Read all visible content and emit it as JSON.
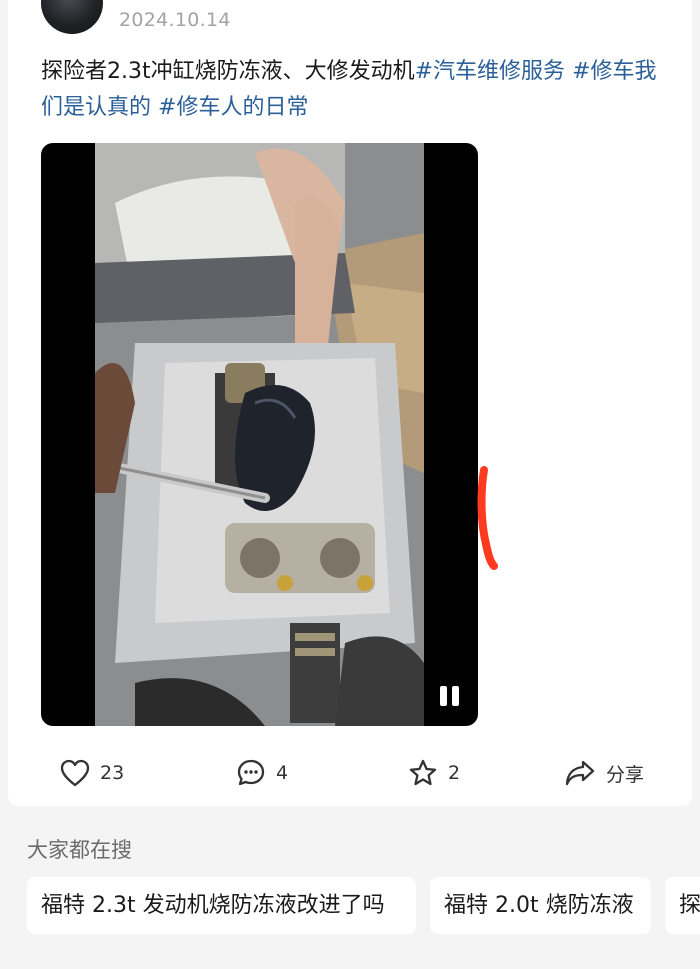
{
  "post": {
    "date": "2024.10.14",
    "text_main": "探险者2.3t冲缸烧防冻液、大修发动机",
    "tags": [
      "#汽车维修服务",
      "#修车我们是认真的",
      "#修车人的日常"
    ]
  },
  "video": {
    "state": "playing",
    "pause_icon": "pause-icon"
  },
  "actions": {
    "like": {
      "icon": "heart-icon",
      "count": "23"
    },
    "comment": {
      "icon": "comment-icon",
      "count": "4"
    },
    "favorite": {
      "icon": "star-icon",
      "count": "2"
    },
    "share": {
      "icon": "share-icon",
      "label": "分享"
    }
  },
  "search": {
    "heading": "大家都在搜",
    "suggestions": [
      "福特 2.3t 发动机烧防冻液改进了吗",
      "福特 2.0t 烧防冻液",
      "探"
    ]
  },
  "colors": {
    "tag": "#2b5f99",
    "annotation": "#ff3b1f",
    "background": "#f4f4f4"
  }
}
